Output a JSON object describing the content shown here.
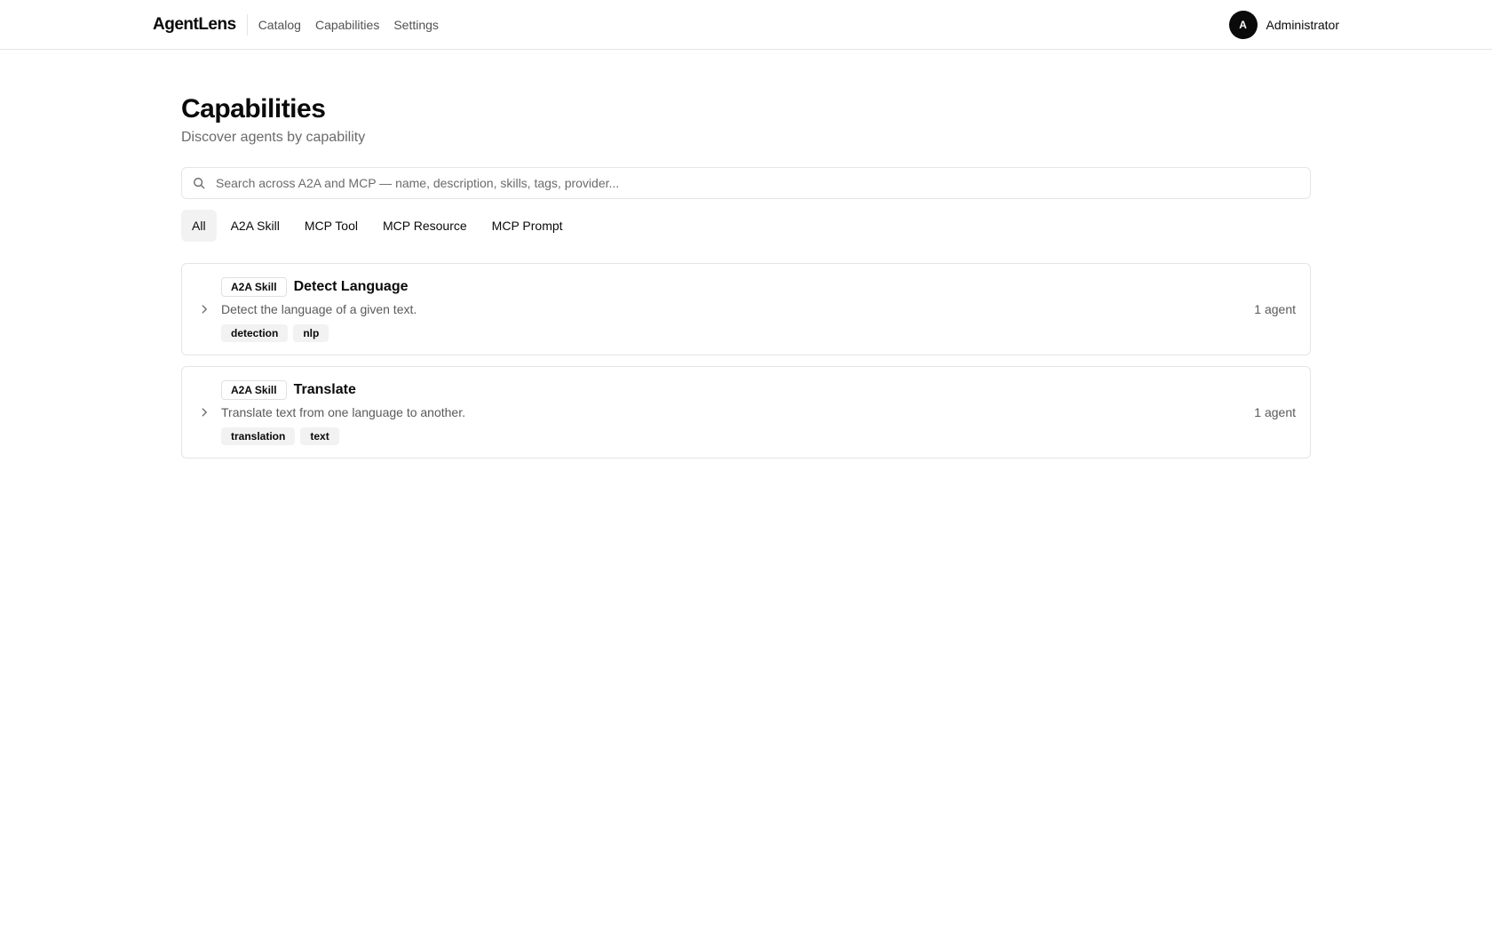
{
  "header": {
    "brand": "AgentLens",
    "nav": [
      {
        "label": "Catalog"
      },
      {
        "label": "Capabilities"
      },
      {
        "label": "Settings"
      }
    ],
    "user": {
      "initial": "A",
      "name": "Administrator"
    }
  },
  "page": {
    "title": "Capabilities",
    "subtitle": "Discover agents by capability"
  },
  "search": {
    "placeholder": "Search across A2A and MCP — name, description, skills, tags, provider...",
    "value": ""
  },
  "filters": [
    {
      "label": "All",
      "active": true
    },
    {
      "label": "A2A Skill",
      "active": false
    },
    {
      "label": "MCP Tool",
      "active": false
    },
    {
      "label": "MCP Resource",
      "active": false
    },
    {
      "label": "MCP Prompt",
      "active": false
    }
  ],
  "capabilities": [
    {
      "type": "A2A Skill",
      "name": "Detect Language",
      "description": "Detect the language of a given text.",
      "tags": [
        "detection",
        "nlp"
      ],
      "agent_count": "1 agent"
    },
    {
      "type": "A2A Skill",
      "name": "Translate",
      "description": "Translate text from one language to another.",
      "tags": [
        "translation",
        "text"
      ],
      "agent_count": "1 agent"
    }
  ],
  "icons": {
    "search": "search-icon",
    "expand": "chevron-right-icon"
  },
  "colors": {
    "text": "#0a0a0a",
    "muted": "#6b6b6b",
    "border": "#e5e5e5",
    "chip": "#f2f2f2"
  }
}
